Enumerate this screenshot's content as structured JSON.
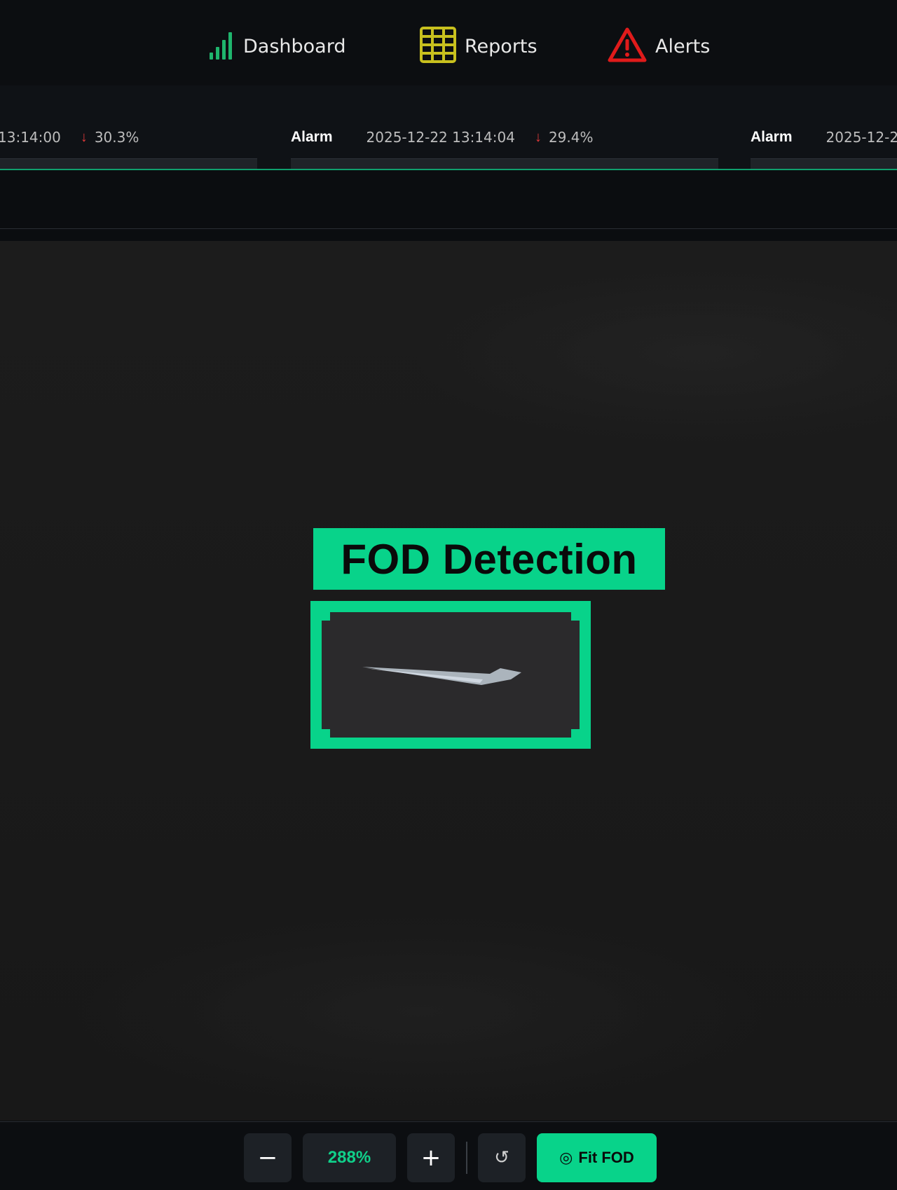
{
  "nav": {
    "items": [
      {
        "label": "Dashboard",
        "icon": "signal-bars-icon",
        "color": "#1fb56d"
      },
      {
        "label": "Reports",
        "icon": "grid-icon",
        "color": "#c8c01e"
      },
      {
        "label": "Alerts",
        "icon": "warning-triangle-icon",
        "color": "#e01b1b"
      }
    ]
  },
  "alarms": [
    {
      "tag": "",
      "time": "13:14:00",
      "trend": "↓",
      "percent": "30.3%"
    },
    {
      "tag": "Alarm",
      "time": "2025-12-22 13:14:04",
      "trend": "↓",
      "percent": "29.4%"
    },
    {
      "tag": "Alarm",
      "time": "2025-12-2",
      "trend": "",
      "percent": ""
    }
  ],
  "viewer": {
    "detection_label": "FOD Detection",
    "accent_color": "#08d38a"
  },
  "toolbar": {
    "zoom_out": "−",
    "zoom_level": "288%",
    "zoom_in": "+",
    "reset_icon": "↺",
    "fit_icon": "◎",
    "fit_label": "Fit FOD"
  }
}
